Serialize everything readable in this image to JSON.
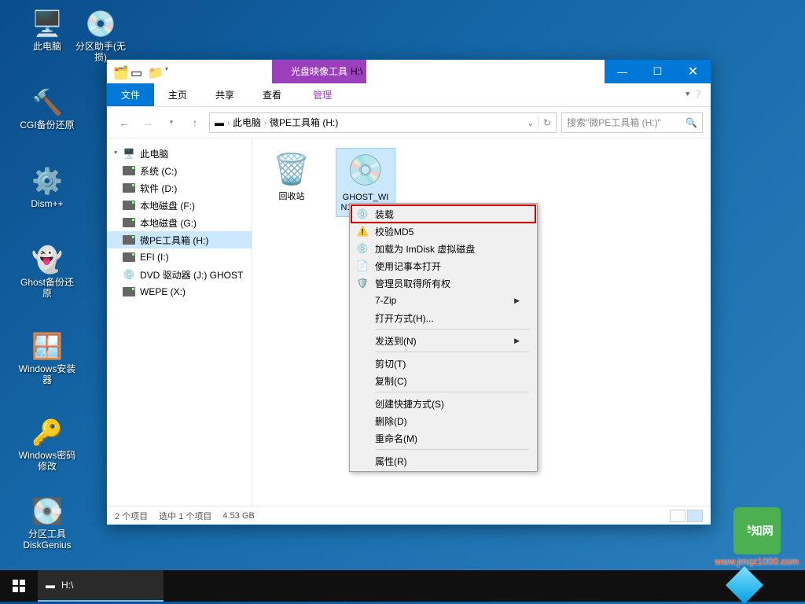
{
  "desktop": {
    "icons": [
      {
        "name": "this-pc",
        "label": "此电脑",
        "glyph": "🖥️"
      },
      {
        "name": "partition-assistant",
        "label": "分区助手(无损)",
        "glyph": "💿"
      },
      {
        "name": "cgi-backup",
        "label": "CGI备份还原",
        "glyph": "🔨"
      },
      {
        "name": "dism",
        "label": "Dism++",
        "glyph": "⚙️"
      },
      {
        "name": "ghost-backup",
        "label": "Ghost备份还原",
        "glyph": "👻"
      },
      {
        "name": "windows-installer",
        "label": "Windows安装器",
        "glyph": "🪟"
      },
      {
        "name": "windows-password",
        "label": "Windows密码修改",
        "glyph": "🔑"
      },
      {
        "name": "diskgenius",
        "label": "分区工具DiskGenius",
        "glyph": "💽"
      }
    ]
  },
  "window": {
    "context_tab": "光盘映像工具",
    "title_location": "H:\\",
    "ribbon": {
      "file": "文件",
      "home": "主页",
      "share": "共享",
      "view": "查看",
      "manage": "管理"
    },
    "breadcrumb": {
      "root": "此电脑",
      "current": "微PE工具箱 (H:)"
    },
    "search_placeholder": "搜索\"微PE工具箱 (H:)\"",
    "sidebar": {
      "root": "此电脑",
      "items": [
        {
          "label": "系统 (C:)",
          "type": "disk"
        },
        {
          "label": "软件 (D:)",
          "type": "disk"
        },
        {
          "label": "本地磁盘 (F:)",
          "type": "disk"
        },
        {
          "label": "本地磁盘 (G:)",
          "type": "disk"
        },
        {
          "label": "微PE工具箱 (H:)",
          "type": "disk",
          "selected": true
        },
        {
          "label": "EFI (I:)",
          "type": "disk"
        },
        {
          "label": "DVD 驱动器 (J:) GHOST",
          "type": "dvd"
        },
        {
          "label": "WEPE (X:)",
          "type": "disk"
        }
      ]
    },
    "files": [
      {
        "name": "recycle-bin",
        "label": "回收站",
        "glyph": "🗑️"
      },
      {
        "name": "ghost-iso",
        "label": "GHOST_WIN10_X64.iso",
        "glyph": "💿",
        "selected": true
      }
    ],
    "status": {
      "count": "2 个项目",
      "selection": "选中 1 个项目",
      "size": "4.53 GB"
    }
  },
  "context_menu": {
    "items": [
      {
        "label": "装载",
        "icon": "💿",
        "highlight": true
      },
      {
        "label": "校验MD5",
        "icon": "⚠️"
      },
      {
        "label": "加载为 ImDisk 虚拟磁盘",
        "icon": "💿"
      },
      {
        "label": "使用记事本打开",
        "icon": "📄"
      },
      {
        "label": "管理员取得所有权",
        "icon": "🛡️"
      },
      {
        "label": "7-Zip",
        "submenu": true
      },
      {
        "label": "打开方式(H)..."
      },
      {
        "sep": true
      },
      {
        "label": "发送到(N)",
        "submenu": true
      },
      {
        "sep": true
      },
      {
        "label": "剪切(T)"
      },
      {
        "label": "复制(C)"
      },
      {
        "sep": true
      },
      {
        "label": "创建快捷方式(S)"
      },
      {
        "label": "删除(D)"
      },
      {
        "label": "重命名(M)"
      },
      {
        "sep": true
      },
      {
        "label": "属性(R)"
      }
    ]
  },
  "taskbar": {
    "active": "H:\\"
  },
  "watermark": {
    "text": "学知网",
    "url": "www.jmqz1000.com"
  }
}
